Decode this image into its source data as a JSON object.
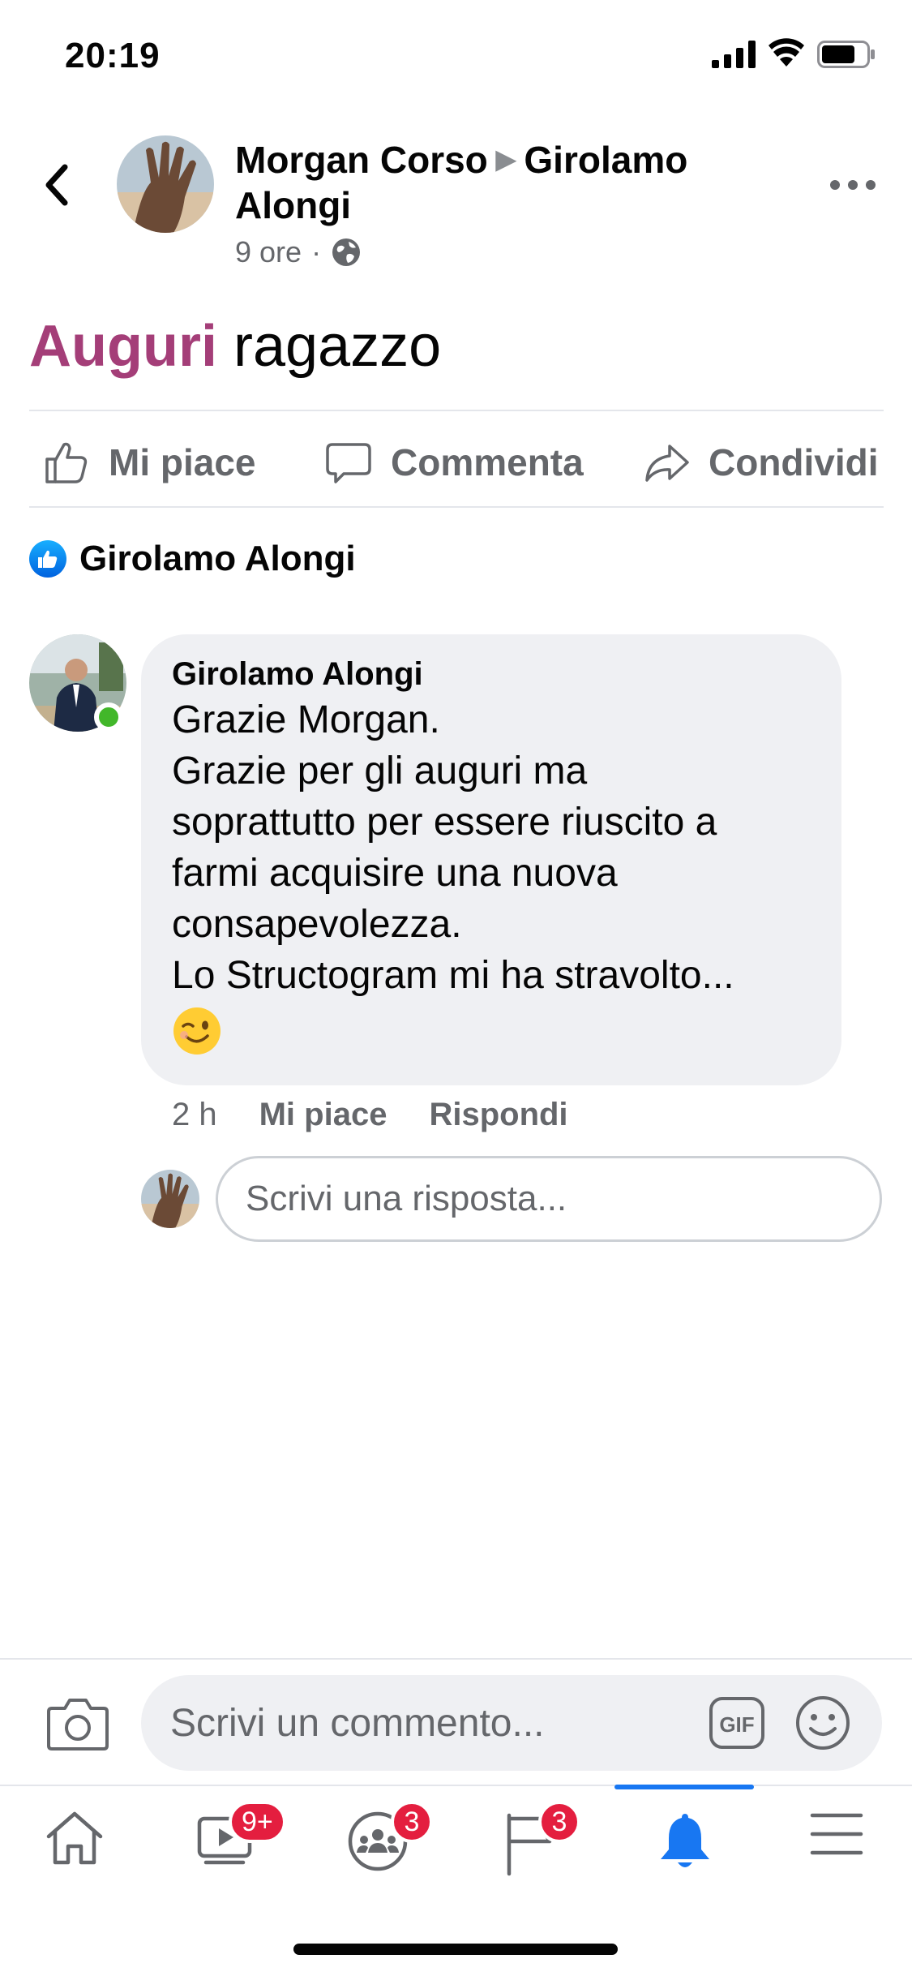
{
  "status_bar": {
    "time": "20:19"
  },
  "post": {
    "author": "Morgan Corso",
    "target": "Girolamo Alongi",
    "time": "9 ore",
    "separator": "·",
    "audience_icon": "globe-icon",
    "text_highlight": "Auguri",
    "text_rest": " ragazzo",
    "highlight_color": "#a43e78"
  },
  "actions": {
    "like": "Mi piace",
    "comment": "Commenta",
    "share": "Condividi"
  },
  "reactions": {
    "icon": "like-reaction-icon",
    "names": "Girolamo Alongi"
  },
  "comment": {
    "author": "Girolamo Alongi",
    "lines": [
      "Grazie Morgan.",
      "Grazie per gli auguri ma",
      "soprattutto per essere riuscito a",
      "farmi acquisire una nuova",
      "consapevolezza.",
      "Lo Structogram mi ha stravolto..."
    ],
    "emoji": "winking-face-icon",
    "time": "2 h",
    "like": "Mi piace",
    "reply": "Rispondi",
    "online": true
  },
  "reply_box": {
    "placeholder": "Scrivi una risposta..."
  },
  "composer": {
    "placeholder": "Scrivi un commento...",
    "gif_label": "GIF"
  },
  "tabbar": {
    "tabs": [
      {
        "name": "home",
        "icon": "home-icon",
        "badge": ""
      },
      {
        "name": "watch",
        "icon": "video-icon",
        "badge": "9+"
      },
      {
        "name": "groups",
        "icon": "groups-icon",
        "badge": "3"
      },
      {
        "name": "pages",
        "icon": "flag-icon",
        "badge": "3"
      },
      {
        "name": "notifications",
        "icon": "bell-icon",
        "badge": "",
        "active": true
      },
      {
        "name": "menu",
        "icon": "hamburger-menu-icon",
        "badge": ""
      }
    ],
    "badge_color": "#e41e3f",
    "accent_color": "#1877f2"
  }
}
